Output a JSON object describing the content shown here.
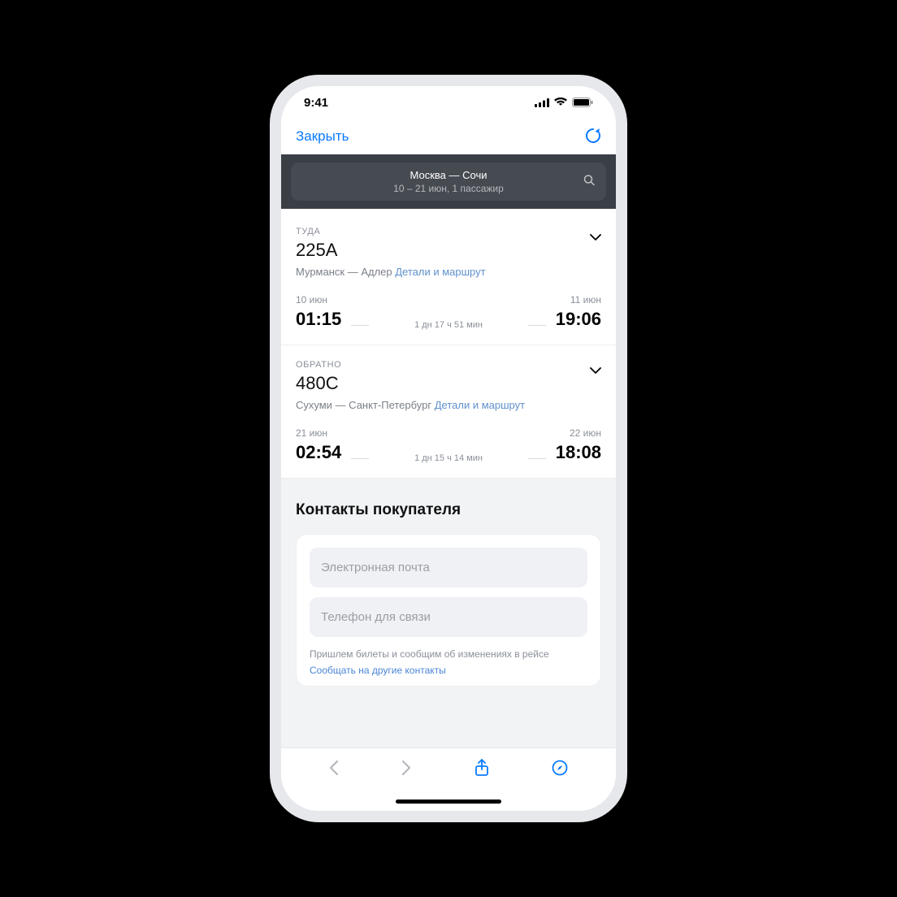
{
  "statusbar": {
    "time": "9:41"
  },
  "navbar": {
    "close": "Закрыть"
  },
  "search": {
    "route": "Москва — Сочи",
    "sub": "10 – 21 июн, 1 пассажир"
  },
  "trips": [
    {
      "dir": "ТУДА",
      "num": "225А",
      "route": "Мурманск — Адлер ",
      "details": "Детали и маршрут",
      "dep_date": "10 июн",
      "dep_time": "01:15",
      "duration": "1 дн 17 ч 51 мин",
      "arr_date": "11 июн",
      "arr_time": "19:06"
    },
    {
      "dir": "ОБРАТНО",
      "num": "480С",
      "route": "Сухуми — Санкт-Петербург ",
      "details": "Детали и маршрут",
      "dep_date": "21 июн",
      "dep_time": "02:54",
      "duration": "1 дн 15 ч 14 мин",
      "arr_date": "22 июн",
      "arr_time": "18:08"
    }
  ],
  "contacts": {
    "heading": "Контакты покупателя",
    "email_placeholder": "Электронная почта",
    "phone_placeholder": "Телефон для связи",
    "hint": "Пришлем билеты и сообщим об изменениях в рейсе",
    "hint_link": "Сообщать на другие контакты"
  }
}
